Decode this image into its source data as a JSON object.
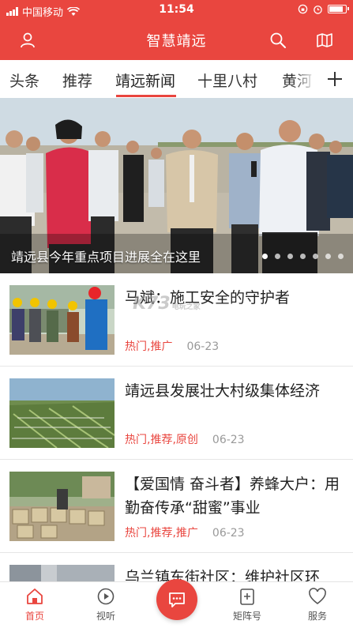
{
  "status_bar": {
    "carrier": "中国移动",
    "time": "11:54",
    "battery_level": 0.92
  },
  "app_bar": {
    "title": "智慧靖远",
    "icons": [
      "user-icon",
      "search-icon",
      "map-icon"
    ]
  },
  "tabs": [
    {
      "label": "头条",
      "active": false
    },
    {
      "label": "推荐",
      "active": false
    },
    {
      "label": "靖远新闻",
      "active": true
    },
    {
      "label": "十里八村",
      "active": false
    },
    {
      "label": "黄河",
      "active": false
    }
  ],
  "banner": {
    "caption": "靖远县今年重点项目进展全在这里",
    "dot_count": 7,
    "active_dot": 0
  },
  "news": [
    {
      "title": "马斌：施工安全的守护者",
      "tags": "热门,推广",
      "date": "06-23"
    },
    {
      "title": "靖远县发展壮大村级集体经济",
      "tags": "热门,推荐,原创",
      "date": "06-23"
    },
    {
      "title": "【爱国情 奋斗者】养蜂大户：用勤奋传承“甜蜜”事业",
      "tags": "热门,推荐,推广",
      "date": "06-23"
    },
    {
      "title": "乌兰镇东街社区：维护社区环",
      "tags": "",
      "date": ""
    }
  ],
  "watermark": {
    "main": "K73",
    "sub": "电玩之家"
  },
  "bottom_nav": [
    {
      "label": "首页",
      "active": true,
      "icon": "home-icon"
    },
    {
      "label": "视听",
      "active": false,
      "icon": "play-icon"
    },
    {
      "label": "",
      "active": false,
      "icon": "chat-icon"
    },
    {
      "label": "矩阵号",
      "active": false,
      "icon": "matrix-icon"
    },
    {
      "label": "服务",
      "active": false,
      "icon": "heart-icon"
    }
  ],
  "colors": {
    "accent": "#e9463f",
    "text": "#222222",
    "muted": "#999999"
  }
}
